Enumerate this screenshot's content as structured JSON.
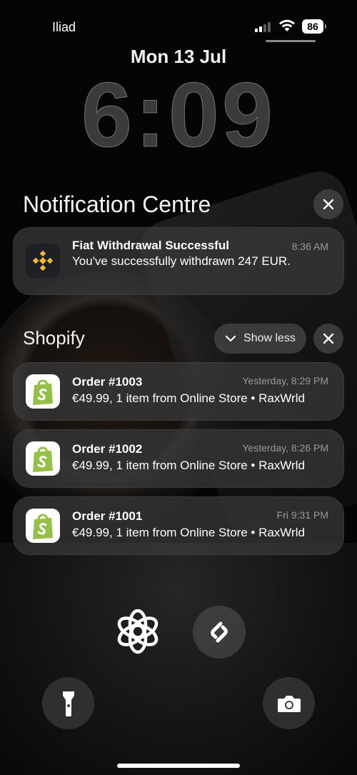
{
  "status_bar": {
    "carrier": "Iliad",
    "battery": "86"
  },
  "lock_screen": {
    "date": "Mon 13 Jul",
    "time": "6:09"
  },
  "notification_centre": {
    "title": "Notification Centre",
    "binance": {
      "app_icon": "binance-icon",
      "title": "Fiat Withdrawal Successful",
      "body": "You've successfully withdrawn  247 EUR.",
      "time": "8:36 AM"
    }
  },
  "shopify_group": {
    "title": "Shopify",
    "show_less_label": "Show less",
    "notifications": [
      {
        "title": "Order #1003",
        "body": "€49.99, 1 item from Online Store • RaxWrld",
        "time": "Yesterday, 8:29 PM"
      },
      {
        "title": "Order #1002",
        "body": "€49.99, 1 item from Online Store • RaxWrld",
        "time": "Yesterday, 8:26 PM"
      },
      {
        "title": "Order #1001",
        "body": "€49.99, 1 item from Online Store • RaxWrld",
        "time": "Fri 9:31 PM"
      }
    ]
  },
  "widgets": {
    "left": "openai-icon",
    "right": "shazam-icon"
  },
  "quick_actions": {
    "left": "flashlight-icon",
    "right": "camera-icon"
  },
  "colors": {
    "shopify_green": "#95BF47",
    "binance_yellow": "#F3BA2F"
  }
}
